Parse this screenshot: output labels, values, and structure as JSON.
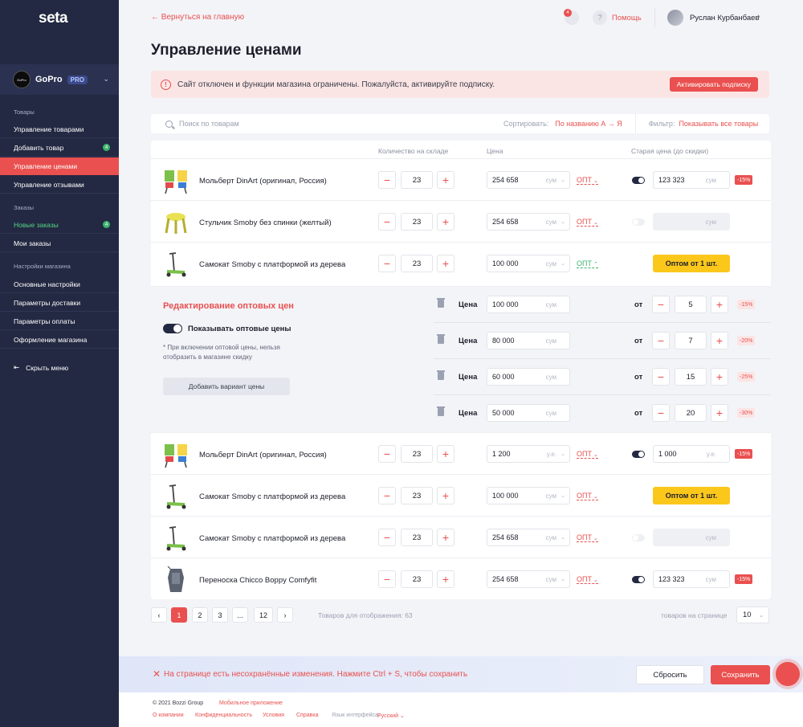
{
  "sidebar": {
    "logo": "seta",
    "store": {
      "avatar_text": "GoPro",
      "name": "GoPro",
      "badge": "PRO"
    },
    "sections": {
      "products": "Товары",
      "orders": "Заказы",
      "settings": "Настройки магазина"
    },
    "items": {
      "manage_products": "Управление товарами",
      "add_product": "Добавить товар",
      "add_product_count": "4",
      "manage_prices": "Управление ценами",
      "manage_reviews": "Управление отзывами",
      "new_orders": "Новые заказы",
      "new_orders_count": "4",
      "my_orders": "Мои заказы",
      "basic_settings": "Основные настройки",
      "delivery": "Параметры доставки",
      "payment": "Параметры оплаты",
      "design": "Оформление магазина"
    },
    "hide_menu": "Скрыть меню"
  },
  "topbar": {
    "back": "← Вернуться на главную",
    "notifications_count": "4",
    "help": "Помощь",
    "user_name": "Руслан Курбанбаев"
  },
  "page_title": "Управление ценами",
  "alert": {
    "text": "Сайт отключен и функции магазина ограничены. Пожалуйста, активируйте подписку.",
    "button": "Активировать подписку"
  },
  "filters": {
    "search_placeholder": "Поиск по товарам",
    "sort_label": "Сортировать:",
    "sort_value": "По названию А → Я",
    "filter_label": "Фильтр:",
    "filter_value": "Показывать все товары"
  },
  "table": {
    "headers": {
      "stock": "Количество на складе",
      "price": "Цена",
      "old_price": "Старая цена (до скидки)"
    },
    "opt_label": "ОПТ",
    "wholesale_button": "Оптом от 1 шт.",
    "rows_top": [
      {
        "name": "Мольберт DinArt (оригинал, Россия)",
        "qty": "23",
        "price": "254 658",
        "currency": "сум",
        "toggle": "on",
        "old_price": "123 323",
        "old_currency": "сум",
        "discount": "-15%"
      },
      {
        "name": "Стульчик Smoby без спинки (желтый)",
        "qty": "23",
        "price": "254 658",
        "currency": "сум",
        "toggle": "off",
        "old_price": "",
        "old_currency": "сум",
        "discount": ""
      },
      {
        "name": "Самокат Smoby с платформой из дерева",
        "qty": "23",
        "price": "100 000",
        "currency": "сум",
        "toggle": "wholesale",
        "old_price": "",
        "old_currency": "",
        "discount": ""
      }
    ],
    "wholesale_panel": {
      "title": "Редактирование оптовых цен",
      "toggle_label": "Показывать оптовые цены",
      "note": "* При включении оптовой цены, нельзя отобразить в магазине скидку",
      "add_button": "Добавить вариант цены",
      "price_label": "Цена",
      "from_label": "от",
      "currency": "сум",
      "tiers": [
        {
          "price": "100 000",
          "qty": "5",
          "discount": "-15%"
        },
        {
          "price": "80 000",
          "qty": "7",
          "discount": "-20%"
        },
        {
          "price": "60 000",
          "qty": "15",
          "discount": "-25%"
        },
        {
          "price": "50 000",
          "qty": "20",
          "discount": "-30%"
        }
      ]
    },
    "rows_bottom": [
      {
        "name": "Мольберт DinArt (оригинал, Россия)",
        "qty": "23",
        "price": "1 200",
        "currency": "у.е.",
        "toggle": "on",
        "old_price": "1 000",
        "old_currency": "у.е.",
        "discount": "-15%"
      },
      {
        "name": "Самокат Smoby с платформой из дерева",
        "qty": "23",
        "price": "100 000",
        "currency": "сум",
        "toggle": "wholesale",
        "old_price": "",
        "old_currency": "",
        "discount": ""
      },
      {
        "name": "Самокат Smoby с платформой из дерева",
        "qty": "23",
        "price": "254 658",
        "currency": "сум",
        "toggle": "off",
        "old_price": "",
        "old_currency": "сум",
        "discount": ""
      },
      {
        "name": "Переноска Chicco Boppy Comfyfit",
        "qty": "23",
        "price": "254 658",
        "currency": "сум",
        "toggle": "on",
        "old_price": "123 323",
        "old_currency": "сум",
        "discount": "-15%"
      }
    ]
  },
  "pagination": {
    "pages": [
      "1",
      "2",
      "3",
      "...",
      "12"
    ],
    "active": "1",
    "count_text": "Товаров для отображения: 63",
    "per_page_label": "товаров на странице",
    "per_page_value": "10"
  },
  "save_bar": {
    "text": "На странице есть несохранённые изменения. Нажмите Ctrl + S, чтобы сохранить",
    "reset": "Сбросить",
    "save": "Сохранить"
  },
  "footer": {
    "copyright": "© 2021 Bozzi Group",
    "mobile_app": "Мобильное приложение",
    "links": [
      "О компании",
      "Конфиденциальность",
      "Условия",
      "Справка"
    ],
    "lang_label": "Язык интерфейса:",
    "lang_value": "Русский"
  },
  "colors": {
    "accent": "#e9504f",
    "sidebar": "#232942",
    "wholesale": "#fbc71b",
    "success": "#3bb36e"
  }
}
